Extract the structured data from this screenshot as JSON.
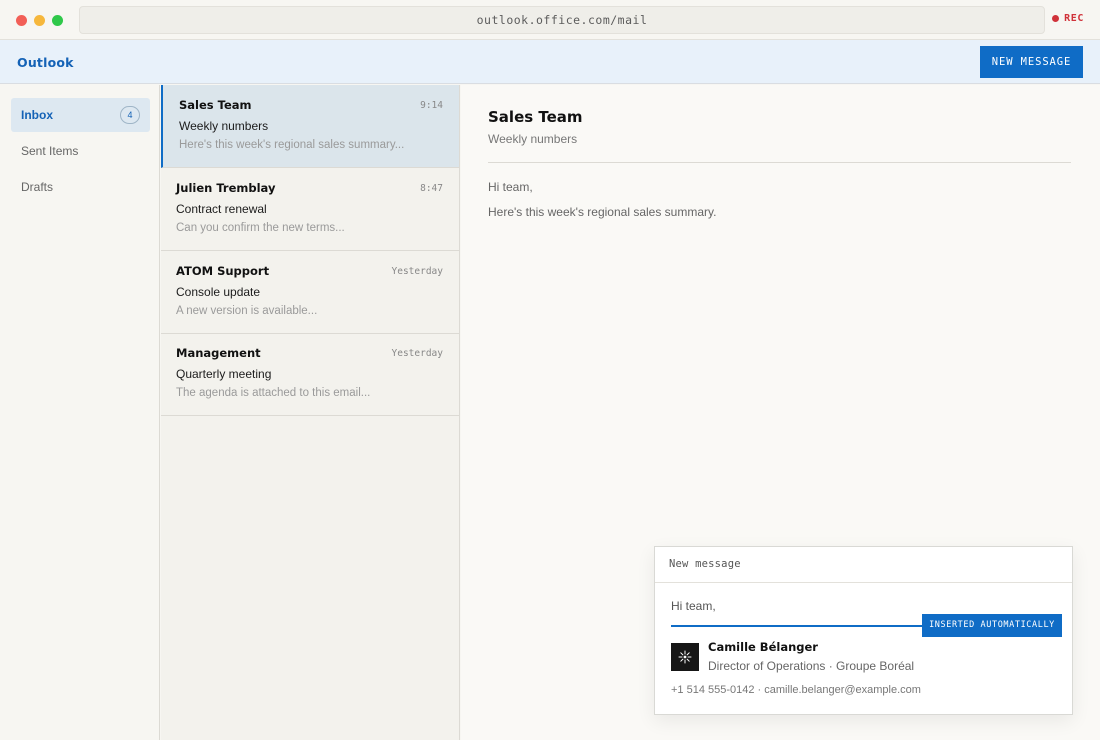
{
  "browser": {
    "url": "outlook.office.com/mail",
    "rec_label": "REC"
  },
  "app": {
    "name": "Outlook",
    "new_message_label": "NEW MESSAGE"
  },
  "folders": [
    {
      "label": "Inbox",
      "badge": "4",
      "active": true
    },
    {
      "label": "Sent Items"
    },
    {
      "label": "Drafts"
    }
  ],
  "messages": [
    {
      "sender": "Sales Team",
      "time": "9:14",
      "subject": "Weekly numbers",
      "preview": "Here's this week's regional sales summary...",
      "selected": true
    },
    {
      "sender": "Julien Tremblay",
      "time": "8:47",
      "subject": "Contract renewal",
      "preview": "Can you confirm the new terms..."
    },
    {
      "sender": "ATOM Support",
      "time": "Yesterday",
      "subject": "Console update",
      "preview": "A new version is available..."
    },
    {
      "sender": "Management",
      "time": "Yesterday",
      "subject": "Quarterly meeting",
      "preview": "The agenda is attached to this email..."
    }
  ],
  "reading": {
    "sender": "Sales Team",
    "subject": "Weekly numbers",
    "greeting": "Hi team,",
    "body": "Here's this week's regional sales summary."
  },
  "compose": {
    "title": "New message",
    "greeting": "Hi team,",
    "auto_badge": "INSERTED AUTOMATICALLY",
    "signature": {
      "name": "Camille Bélanger",
      "title": "Director of Operations · Groupe Boréal",
      "contact": "+1 514 555-0142 · camille.belanger@example.com"
    }
  }
}
